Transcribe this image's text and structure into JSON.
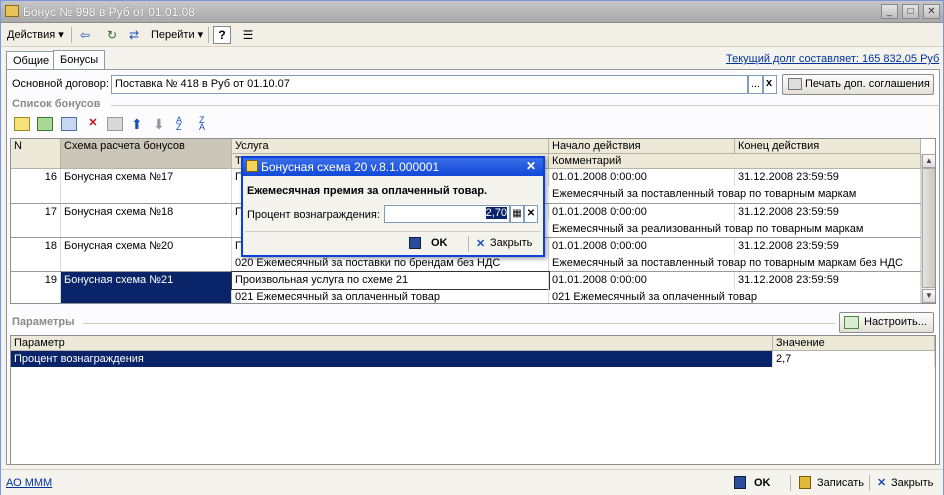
{
  "window": {
    "title": "Бонус № 998 в Руб от 01.01.08"
  },
  "toolbar": {
    "actions_label": "Действия",
    "goto_label": "Перейти",
    "help_label": "?"
  },
  "tabs": [
    {
      "label": "Общие"
    },
    {
      "label": "Бонусы"
    }
  ],
  "debt_link": "Текущий долг составляет: 165 832,05 Руб",
  "contract": {
    "label": "Основной договор:",
    "value": "Поставка № 418 в Руб от 01.10.07",
    "dots": "...",
    "clear": "x",
    "print_label": "Печать доп. соглашения"
  },
  "bonus_list": {
    "title": "Список бонусов",
    "headers": {
      "n": "N",
      "scheme": "Схема расчета бонусов",
      "service": "Услуга",
      "service_sub": "Т",
      "start": "Начало действия",
      "end": "Конец действия",
      "comment": "Комментарий"
    },
    "rows": [
      {
        "n": "16",
        "scheme": "Бонусная схема №17",
        "service": "П",
        "service2": "",
        "start": "01.01.2008 0:00:00",
        "end": "31.12.2008 23:59:59",
        "comment": "Ежемесячный за поставленный товар по товарным маркам"
      },
      {
        "n": "17",
        "scheme": "Бонусная схема №18",
        "service": "П",
        "service2": "",
        "start": "01.01.2008 0:00:00",
        "end": "31.12.2008 23:59:59",
        "comment": "Ежемесячный за реализованный товар по товарным маркам"
      },
      {
        "n": "18",
        "scheme": "Бонусная схема №20",
        "service": "П",
        "service2": "020 Ежемесячный за поставки по брендам без НДС",
        "start": "01.01.2008 0:00:00",
        "end": "31.12.2008 23:59:59",
        "comment": "Ежемесячный за поставленный товар по товарным маркам без НДС"
      },
      {
        "n": "19",
        "scheme": "Бонусная схема №21",
        "service": "Произвольная услуга по схеме 21",
        "service2": "021 Ежемесячный за оплаченный товар",
        "start": "01.01.2008 0:00:00",
        "end": "31.12.2008 23:59:59",
        "comment": "021 Ежемесячный за оплаченный товар"
      }
    ]
  },
  "params": {
    "title": "Параметры",
    "configure_label": "Настроить...",
    "headers": {
      "param": "Параметр",
      "value": "Значение"
    },
    "rows": [
      {
        "param": "Процент вознаграждения",
        "value": "2,7"
      }
    ]
  },
  "dialog": {
    "title": "Бонусная схема 20 v.8.1.000001",
    "heading": "Ежемесячная премия за оплаченный товар.",
    "field_label": "Процент вознаграждения:",
    "field_value": "2,70",
    "ok_label": "OK",
    "close_label": "Закрыть"
  },
  "footer": {
    "org_link": "АО МММ",
    "ok_label": "OK",
    "save_label": "Записать",
    "close_label": "Закрыть"
  },
  "colors": {
    "selection": "#0a246a",
    "dialog_title": "#1148d8",
    "link": "#00339b"
  }
}
